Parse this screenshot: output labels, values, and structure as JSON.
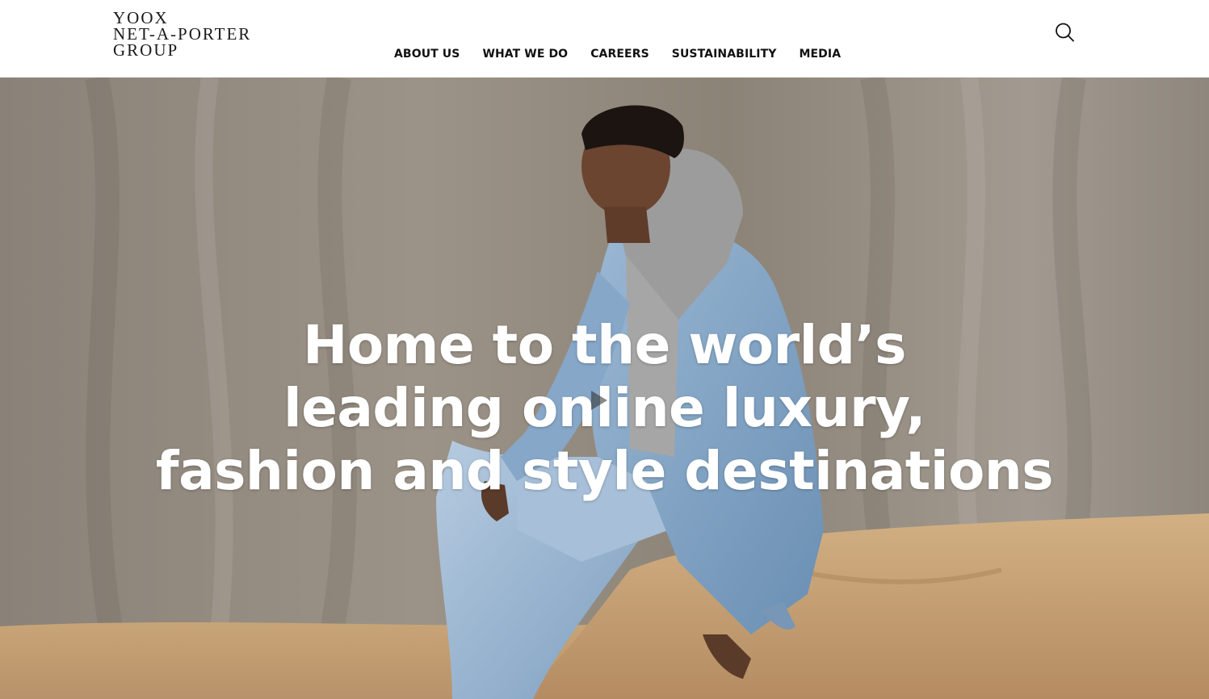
{
  "header": {
    "logo": {
      "line1": "YOOX",
      "line2": "NET-A-PORTER",
      "line3": "GROUP"
    },
    "nav": [
      {
        "label": "ABOUT US"
      },
      {
        "label": "WHAT WE DO"
      },
      {
        "label": "CAREERS"
      },
      {
        "label": "SUSTAINABILITY"
      },
      {
        "label": "MEDIA"
      }
    ],
    "search_icon": "search-icon"
  },
  "hero": {
    "headline": {
      "line1": "Home to the world’s",
      "line2": "leading online luxury,",
      "line3": "fashion and style destinations"
    },
    "play_icon": "play-icon"
  },
  "colors": {
    "header_bg": "#ffffff",
    "nav_text": "#111111",
    "headline_text": "#ffffff",
    "backdrop": "#8f877d",
    "floor": "#c8a57a",
    "denim": "#7fa3c6"
  }
}
